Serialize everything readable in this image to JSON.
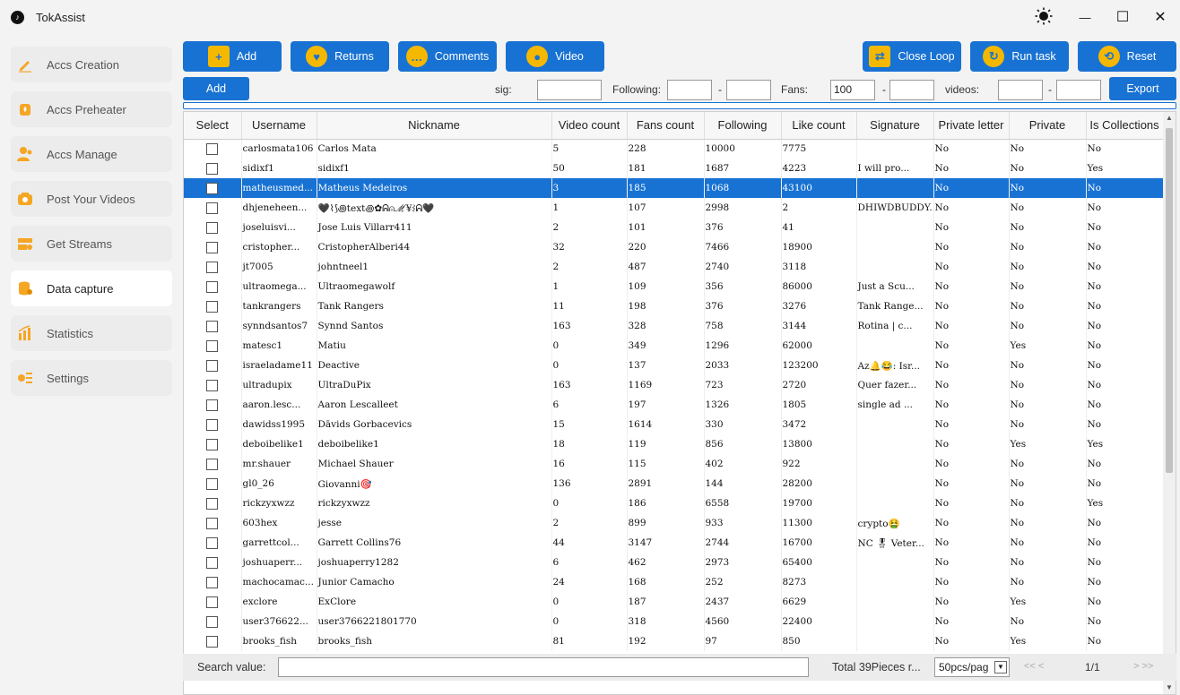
{
  "app": {
    "title": "TokAssist",
    "logo_icon": "tiktok-icon"
  },
  "window": {
    "theme_icon": "sun-icon",
    "minimize": "—",
    "maximize": "☐",
    "close": "✕"
  },
  "sidebar": {
    "items": [
      {
        "label": "Accs Creation",
        "icon": "pencil-icon",
        "active": false
      },
      {
        "label": "Accs Preheater",
        "icon": "flame-icon",
        "active": false
      },
      {
        "label": "Accs Manage",
        "icon": "users-icon",
        "active": false
      },
      {
        "label": "Post Your Videos",
        "icon": "camera-icon",
        "active": false
      },
      {
        "label": "Get Streams",
        "icon": "stream-icon",
        "active": false
      },
      {
        "label": "Data capture",
        "icon": "database-icon",
        "active": true
      },
      {
        "label": "Statistics",
        "icon": "bar-chart-icon",
        "active": false
      },
      {
        "label": "Settings",
        "icon": "settings-list-icon",
        "active": false
      }
    ]
  },
  "toolbar": {
    "add": "Add",
    "returns": "Returns",
    "comments": "Comments",
    "video": "Video",
    "close_loop": "Close Loop",
    "run_task": "Run task",
    "reset": "Reset"
  },
  "filters": {
    "add_button": "Add",
    "sig_label": "sig:",
    "sig_value": "",
    "following_label": "Following:",
    "following_min": "",
    "following_max": "",
    "fans_label": "Fans:",
    "fans_min": "100",
    "fans_max": "",
    "videos_label": "videos:",
    "videos_min": "",
    "videos_max": "",
    "dash": "-",
    "export_button": "Export"
  },
  "table": {
    "columns": [
      "Select",
      "Username",
      "Nickname",
      "Video count",
      "Fans count",
      "Following",
      "Like count",
      "Signature",
      "Private letter",
      "Private",
      "Is Collections"
    ],
    "selected_row": 2,
    "rows": [
      [
        "carlosmata106",
        "Carlos Mata",
        "5",
        "228",
        "10000",
        "7775",
        "",
        "No",
        "No",
        "No"
      ],
      [
        "sidixf1",
        "sidixf1",
        "50",
        "181",
        "1687",
        "4223",
        "I will pro...",
        "No",
        "No",
        "Yes"
      ],
      [
        "matheusmed...",
        "Matheus Medeiros",
        "3",
        "185",
        "1068",
        "43100",
        "",
        "No",
        "No",
        "No"
      ],
      [
        "dhjeneheen...",
        "🖤⌇⟆꩜text꩜✿ᕱ⍝ℳ¥⌇ᕱ🖤",
        "1",
        "107",
        "2998",
        "2",
        "DHIWDBUDDY...",
        "No",
        "No",
        "No"
      ],
      [
        "joseluisvi...",
        "Jose Luis Villarr411",
        "2",
        "101",
        "376",
        "41",
        "",
        "No",
        "No",
        "No"
      ],
      [
        "cristopher...",
        "CristopherAlberi44",
        "32",
        "220",
        "7466",
        "18900",
        "",
        "No",
        "No",
        "No"
      ],
      [
        "jt7005",
        "johntneel1",
        "2",
        "487",
        "2740",
        "3118",
        "",
        "No",
        "No",
        "No"
      ],
      [
        "ultraomega...",
        "Ultraomegawolf",
        "1",
        "109",
        "356",
        "86000",
        "Just a Scu...",
        "No",
        "No",
        "No"
      ],
      [
        "tankrangers",
        "Tank Rangers",
        "11",
        "198",
        "376",
        "3276",
        "Tank Range...",
        "No",
        "No",
        "No"
      ],
      [
        "synndsantos7",
        "Synnd Santos",
        "163",
        "328",
        "758",
        "3144",
        "Rotina | c...",
        "No",
        "No",
        "No"
      ],
      [
        "matesc1",
        "Matiu",
        "0",
        "349",
        "1296",
        "62000",
        "",
        "No",
        "Yes",
        "No"
      ],
      [
        "israeladame11",
        "Deactive",
        "0",
        "137",
        "2033",
        "123200",
        "Az🔔😂: Isr...",
        "No",
        "No",
        "No"
      ],
      [
        "ultradupix",
        "UltraDuPix",
        "163",
        "1169",
        "723",
        "2720",
        "Quer fazer...",
        "No",
        "No",
        "No"
      ],
      [
        "aaron.lesc...",
        "Aaron Lescalleet",
        "6",
        "197",
        "1326",
        "1805",
        "single ad ...",
        "No",
        "No",
        "No"
      ],
      [
        "dawidss1995",
        "Dāvids Gorbacevics",
        "15",
        "1614",
        "330",
        "3472",
        "",
        "No",
        "No",
        "No"
      ],
      [
        "deboibelike1",
        "deboibelike1",
        "18",
        "119",
        "856",
        "13800",
        "",
        "No",
        "Yes",
        "Yes"
      ],
      [
        "mr.shauer",
        "Michael Shauer",
        "16",
        "115",
        "402",
        "922",
        "",
        "No",
        "No",
        "No"
      ],
      [
        "gl0_26",
        "Giovanni🎯",
        "136",
        "2891",
        "144",
        "28200",
        "",
        "No",
        "No",
        "No"
      ],
      [
        "rickzyxwzz",
        "rickzyxwzz",
        "0",
        "186",
        "6558",
        "19700",
        "",
        "No",
        "No",
        "Yes"
      ],
      [
        "603hex",
        "jesse",
        "2",
        "899",
        "933",
        "11300",
        "crypto🤮",
        "No",
        "No",
        "No"
      ],
      [
        "garrettcol...",
        "Garrett Collins76",
        "44",
        "3147",
        "2744",
        "16700",
        "NC 🎖 Veter...",
        "No",
        "No",
        "No"
      ],
      [
        "joshuaperr...",
        "joshuaperry1282",
        "6",
        "462",
        "2973",
        "65400",
        "",
        "No",
        "No",
        "No"
      ],
      [
        "machocamac...",
        "Junior Camacho",
        "24",
        "168",
        "252",
        "8273",
        "",
        "No",
        "No",
        "No"
      ],
      [
        "exclore",
        "ExClore",
        "0",
        "187",
        "2437",
        "6629",
        "",
        "No",
        "Yes",
        "No"
      ],
      [
        "user376622...",
        "user3766221801770",
        "0",
        "318",
        "4560",
        "22400",
        "",
        "No",
        "No",
        "No"
      ],
      [
        "brooks_fish",
        "brooks_fish",
        "81",
        "192",
        "97",
        "850",
        "",
        "No",
        "Yes",
        "No"
      ]
    ]
  },
  "footer": {
    "search_label": "Search  value:",
    "search_value": "",
    "total": "Total 39Pieces r...",
    "page_size": "50pcs/pag",
    "prev": "<<  <",
    "page": "1/1",
    "next": ">  >>"
  },
  "colors": {
    "accent": "#1872d3",
    "icon_yellow": "#f5b800",
    "sidebar_icon": "#f5a623"
  }
}
